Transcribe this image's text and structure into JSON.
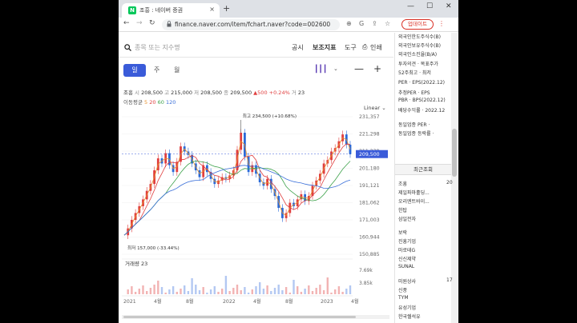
{
  "browser": {
    "tab_title": "조흥 : 네이버 증권",
    "tab_favicon": "N",
    "url": "finance.naver.com/item/fchart.naver?code=002600",
    "update_label": "업데이트",
    "new_tab_label": "+",
    "close_label": "×",
    "minimize_label": "—",
    "maximize_label": "☐",
    "close_window_label": "✕",
    "back_label": "←",
    "forward_label": "→",
    "reload_label": "↻"
  },
  "search": {
    "placeholder": "종목 또는 지수명"
  },
  "top_links": {
    "notice": "공시",
    "indicators": "보조지표",
    "tools": "도구",
    "print": "인쇄"
  },
  "periods": {
    "day": "일",
    "week": "주",
    "month": "월"
  },
  "ohlc": {
    "name": "조흥",
    "open_label": "시",
    "open": "208,500",
    "high_label": "고",
    "high": "215,000",
    "low_label": "저",
    "low": "208,500",
    "close_label": "종",
    "close": "209,500",
    "change": "▲500",
    "change_pct": "+0.24%",
    "volume_label": "거",
    "volume": "23"
  },
  "moving_averages": {
    "label": "이동평균",
    "periods": [
      "5",
      "20",
      "60",
      "120"
    ],
    "colors": [
      "#e8912d",
      "#e03e3e",
      "#3fa34d",
      "#3a6fd9"
    ]
  },
  "scale_label": "Linear",
  "volume_pane": {
    "label": "거래량",
    "value": "23",
    "ticks": [
      "7.69k",
      "3.85k"
    ]
  },
  "colors": {
    "accent": "#3a5bd9",
    "up": "#e03e3e",
    "down": "#2a6ad8"
  },
  "chart_data": {
    "type": "candlestick",
    "y_ticks": [
      "231,357",
      "221,298",
      "211,239",
      "201,180",
      "191,121",
      "181,062",
      "171,003",
      "160,944",
      "150,885"
    ],
    "ylim": [
      150885,
      231357
    ],
    "x_labels": [
      "2021",
      "4월",
      "8월",
      "2022",
      "4월",
      "8월",
      "2023",
      "4월"
    ],
    "max_annotation": "최고 234,500 (+10.68%)",
    "min_annotation": "최저 157,000 (-33.44%)",
    "current_price": "209,500",
    "close_series": [
      162000,
      166000,
      171000,
      175000,
      179000,
      183000,
      188000,
      192000,
      200000,
      207000,
      204000,
      210000,
      203000,
      199000,
      205000,
      214000,
      211000,
      209000,
      204000,
      200000,
      196000,
      203000,
      199000,
      195000,
      192000,
      194000,
      196000,
      195000,
      197000,
      200000,
      212000,
      222000,
      208000,
      199000,
      203000,
      198000,
      193000,
      191000,
      195000,
      189000,
      185000,
      178000,
      172000,
      175000,
      181000,
      179000,
      183000,
      186000,
      182000,
      185000,
      191000,
      194000,
      198000,
      204000,
      206000,
      211000,
      213000,
      217000,
      221000,
      215000,
      209500
    ]
  },
  "sidebar": {
    "top_items": [
      "외국인한도주식수(B)",
      "외국인보유주식수(B)",
      "외국인소진율(B/A)",
      "투자의견 · 목표주가",
      "52주최고 · 최저",
      "PER · EPS(2022.12)",
      "추정PER · EPS",
      "PBR · BPS(2022.12)",
      "배당수익률 · 2022.12",
      "동일업종 PER ·",
      "동일업종 등락률 ·"
    ],
    "recent_header": "최근조회",
    "recent_items": [
      "조흥",
      "제일파마홀딩...",
      "오리엔트바이...",
      "한탑",
      "삼일전자",
      "보락",
      "진흥기업",
      "마로테G",
      "신신제약",
      "SUNAL",
      "미원상사",
      "신풍",
      "TYM",
      "유성기업",
      "한국쉘석유"
    ],
    "recent_nums": [
      "20",
      "",
      "",
      "",
      "",
      "",
      "",
      "",
      "",
      "",
      "17",
      "",
      "",
      "",
      ""
    ]
  }
}
